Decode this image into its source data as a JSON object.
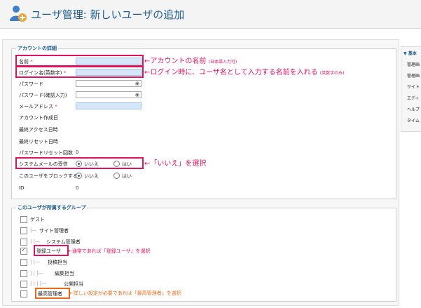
{
  "header": {
    "title": "ユーザ管理: 新しいユーザの追加"
  },
  "account": {
    "legend": "アカウントの詳細",
    "name_label": "名前",
    "login_label": "ログイン名(英数字)",
    "password_label": "パスワード",
    "password_confirm_label": "パスワード(確認入力)",
    "email_label": "メールアドレス",
    "created_label": "アカウント作成日",
    "last_access_label": "最終アクセス日時",
    "last_reset_label": "最終リセット日時",
    "reset_count_label": "パスワードリセット回数",
    "reset_count_value": "0",
    "system_mail_label": "システムメールの受信",
    "block_label": "このユーザをブロックする",
    "id_label": "ID",
    "id_value": "0",
    "radio_no": "いいえ",
    "radio_yes": "はい",
    "required_mark": "*"
  },
  "annotations": {
    "name_note": "←アカウントの名前",
    "name_note_small": "(日本語入力可)",
    "login_note": "←ログイン時に、ユーザ名として入力する名前を入れる",
    "login_note_small": "(英数字のみ)",
    "mail_note": "←「いいえ」を選択",
    "registered_note": "←通常であれば「登録ユーザ」を選択",
    "super_note": "←詳しい設定が必要であれば「最高管理者」を選択"
  },
  "groups": {
    "legend": "このユーザが所属するグループ",
    "items": [
      {
        "label": "ゲスト",
        "checked": false
      },
      {
        "label": "サイト管理者",
        "checked": false
      },
      {
        "label": "システム管理者",
        "checked": false
      },
      {
        "label": "登録ユーザ",
        "checked": true
      },
      {
        "label": "投稿担当",
        "checked": false
      },
      {
        "label": "編集担当",
        "checked": false
      },
      {
        "label": "公開担当",
        "checked": false
      },
      {
        "label": "最高管理者",
        "checked": false
      }
    ]
  },
  "sidebar": {
    "title": "基本",
    "items": [
      "管理画",
      "管理画",
      "サイト",
      "エディ",
      "ヘルプ",
      "タイム"
    ]
  },
  "colors": {
    "annotation_pink": "#e0115f",
    "annotation_orange": "#ea6a1a",
    "header_title": "#1c5c8c"
  },
  "icons": {
    "header": "user-add-icon",
    "password": "eye-icon",
    "collapse": "triangle-down-icon"
  }
}
